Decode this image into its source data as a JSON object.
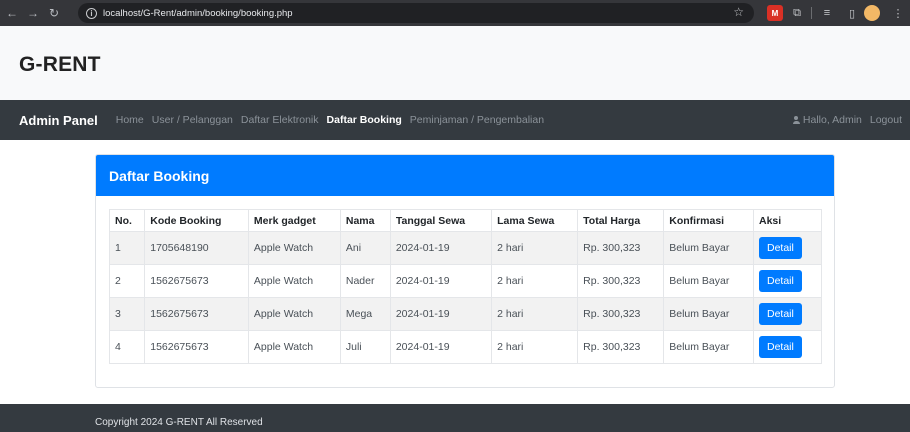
{
  "browser": {
    "back": "←",
    "forward": "→",
    "reload": "↻",
    "url": "localhost/G-Rent/admin/booking/booking.php",
    "star_icon": "star-icon"
  },
  "brand": {
    "name": "G-RENT"
  },
  "navbar": {
    "title": "Admin Panel",
    "links": [
      "Home",
      "User / Pelanggan",
      "Daftar Elektronik",
      "Daftar Booking",
      "Peminjaman / Pengembalian"
    ],
    "active": "Daftar Booking",
    "greeting": "Hallo, Admin",
    "logout": "Logout"
  },
  "card": {
    "header": "Daftar Booking",
    "header_color": "#007bff"
  },
  "table": {
    "columns": [
      "No.",
      "Kode Booking",
      "Merk gadget",
      "Nama",
      "Tanggal Sewa",
      "Lama Sewa",
      "Total Harga",
      "Konfirmasi",
      "Aksi"
    ],
    "rows": [
      {
        "no": "1",
        "kode": "1705648190",
        "merk": "Apple Watch",
        "nama": "Ani",
        "tanggal": "2024-01-19",
        "lama": "2 hari",
        "total": "Rp. 300,323",
        "konfirmasi": "Belum Bayar",
        "aksi": "Detail"
      },
      {
        "no": "2",
        "kode": "1562675673",
        "merk": "Apple Watch",
        "nama": "Nader",
        "tanggal": "2024-01-19",
        "lama": "2 hari",
        "total": "Rp. 300,323",
        "konfirmasi": "Belum Bayar",
        "aksi": "Detail"
      },
      {
        "no": "3",
        "kode": "1562675673",
        "merk": "Apple Watch",
        "nama": "Mega",
        "tanggal": "2024-01-19",
        "lama": "2 hari",
        "total": "Rp. 300,323",
        "konfirmasi": "Belum Bayar",
        "aksi": "Detail"
      },
      {
        "no": "4",
        "kode": "1562675673",
        "merk": "Apple Watch",
        "nama": "Juli",
        "tanggal": "2024-01-19",
        "lama": "2 hari",
        "total": "Rp. 300,323",
        "konfirmasi": "Belum Bayar",
        "aksi": "Detail"
      }
    ]
  },
  "footer": {
    "copyright": "Copyright 2024 G-RENT All Reserved"
  }
}
